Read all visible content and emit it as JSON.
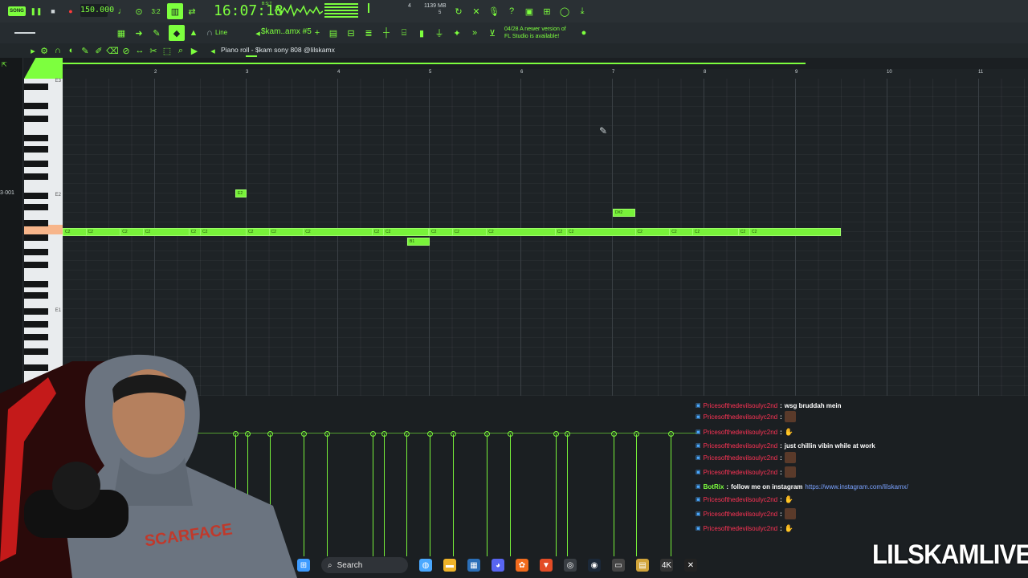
{
  "transport": {
    "song_label": "SONG",
    "tempo": "150.000",
    "time": "16:07:18",
    "time_sub": "B:S:T",
    "memory": "1139 MB",
    "mem_sub": "5",
    "pattern_num": "4"
  },
  "toolbar2": {
    "snap": "Line",
    "pattern": "$kam..amx #5",
    "update_line1": "04/28  A newer version of",
    "update_line2": "FL Studio is available!"
  },
  "pianoroll": {
    "title": "Piano roll - $kam sony 808 @lilskamx",
    "ruler_marks": [
      "2",
      "3",
      "4",
      "5",
      "6",
      "7",
      "8",
      "9",
      "10",
      "11"
    ],
    "key_labels": {
      "e3": "E3",
      "e2": "E2",
      "e1": "E1"
    },
    "left_readout": "3·001"
  },
  "notes": [
    {
      "bar": 1.0,
      "len": 0.25,
      "key": "C2",
      "label": "C2"
    },
    {
      "bar": 1.25,
      "len": 0.375,
      "label": "C2"
    },
    {
      "bar": 1.625,
      "len": 0.25,
      "label": "C2"
    },
    {
      "bar": 1.875,
      "len": 0.5,
      "label": "C2"
    },
    {
      "bar": 2.375,
      "len": 0.125,
      "label": "C2"
    },
    {
      "bar": 2.5,
      "len": 0.375,
      "label": "C2"
    },
    {
      "bar": 3.0,
      "len": 0.25,
      "label": "C2"
    },
    {
      "bar": 3.25,
      "len": 0.375,
      "label": "C2"
    },
    {
      "bar": 3.625,
      "len": 0.75,
      "label": "C2"
    },
    {
      "bar": 4.375,
      "len": 0.125,
      "label": "C2"
    },
    {
      "bar": 4.5,
      "len": 0.25,
      "label": "C2"
    },
    {
      "bar": 5.0,
      "len": 0.25,
      "label": "C2"
    },
    {
      "bar": 5.25,
      "len": 0.375,
      "label": "C2"
    },
    {
      "bar": 5.625,
      "len": 0.75,
      "label": "C2"
    },
    {
      "bar": 6.375,
      "len": 0.125,
      "label": "C2"
    },
    {
      "bar": 6.5,
      "len": 0.5,
      "label": "C2"
    },
    {
      "bar": 7.25,
      "len": 0.375,
      "label": "C2"
    },
    {
      "bar": 7.625,
      "len": 0.25,
      "label": "C2"
    },
    {
      "bar": 7.875,
      "len": 0.5,
      "label": "C2"
    },
    {
      "bar": 8.375,
      "len": 0.125,
      "label": "C2"
    },
    {
      "bar": 8.5,
      "len": 0.5,
      "label": "C2"
    }
  ],
  "extra_notes": [
    {
      "label": "E2"
    },
    {
      "label": "D#2"
    },
    {
      "label": "B1"
    }
  ],
  "chat": [
    {
      "user": "Pricesofthedevilsoulyc2nd",
      "msg": "wsg bruddah mein",
      "type": "text"
    },
    {
      "user": "Pricesofthedevilsoulyc2nd",
      "msg": "",
      "type": "emote"
    },
    {
      "user": "Pricesofthedevilsoulyc2nd",
      "msg": "",
      "type": "hand"
    },
    {
      "user": "Pricesofthedevilsoulyc2nd",
      "msg": "just chillin vibin while at work",
      "type": "text"
    },
    {
      "user": "Pricesofthedevilsoulyc2nd",
      "msg": "",
      "type": "emote"
    },
    {
      "user": "Pricesofthedevilsoulyc2nd",
      "msg": "",
      "type": "emote"
    },
    {
      "user": "BotRix",
      "msg": "follow me on instagram",
      "link": "https://www.instagram.com/lilskamx/",
      "type": "bot"
    },
    {
      "user": "Pricesofthedevilsoulyc2nd",
      "msg": "",
      "type": "hand"
    },
    {
      "user": "Pricesofthedevilsoulyc2nd",
      "msg": "",
      "type": "emote"
    },
    {
      "user": "Pricesofthedevilsoulyc2nd",
      "msg": "",
      "type": "hand"
    }
  ],
  "taskbar": {
    "search": "Search"
  },
  "watermark": "LILSKAMLIVE",
  "webcam_shirt": "SCARFACE",
  "colors": {
    "accent": "#7dff3e",
    "note": "#78f23a",
    "bg": "#1e2326"
  }
}
